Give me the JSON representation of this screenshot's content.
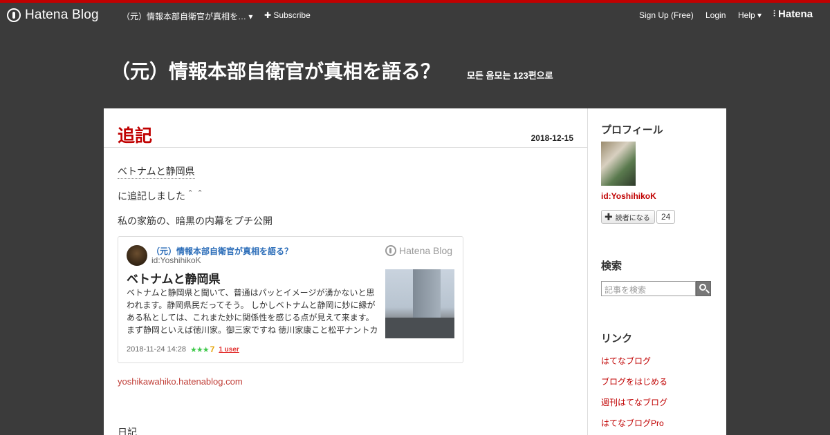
{
  "globalnav": {
    "logo": "Hatena Blog",
    "blog_menu": "（元）情報本部自衛官が真相を… ▾",
    "subscribe": "Subscribe",
    "signup": "Sign Up (Free)",
    "login": "Login",
    "help": "Help ▾",
    "brand": "Hatena"
  },
  "header": {
    "title": "（元）情報本部自衛官が真相を語る？",
    "description": "모든 음모는 123편으로"
  },
  "entry": {
    "title": "追記",
    "date": "2018-12-15",
    "paragraphs": [
      "ベトナムと静岡県",
      "に追記しました＾＾",
      "私の家筋の、暗黒の内幕をプチ公開"
    ],
    "card": {
      "blog_title": "（元）情報本部自衛官が真相を語る？",
      "author_id": "id:YoshihikoK",
      "service": "Hatena Blog",
      "heading": "ベトナムと静岡県",
      "body": "ベトナムと静岡県と聞いて、普通はパッとイメージが湧かないと思われます。静岡県民だってそう。 しかしベトナムと静岡に妙に縁がある私としては、これまた妙に関係性を感じる点が見えて来ます。 まず静岡といえば徳川家。御三家ですね 徳川家康こと松平ナントカ",
      "datetime": "2018-11-24 14:28",
      "stars": "★★★",
      "star_count": "7",
      "users": "1 user"
    },
    "url": "yoshikawahiko.hatenablog.com",
    "category": "日記"
  },
  "sidebar": {
    "profile_heading": "プロフィール",
    "profile_id": "id:YoshihikoK",
    "reader_button": "読者になる",
    "reader_count": "24",
    "search_heading": "検索",
    "search_placeholder": "記事を検索",
    "links_heading": "リンク",
    "links": [
      "はてなブログ",
      "ブログをはじめる",
      "週刊はてなブログ",
      "はてなブログPro"
    ]
  },
  "colors": {
    "accent": "#c00000",
    "header_bg": "#3b3b3b",
    "link": "#2a6cb8"
  }
}
